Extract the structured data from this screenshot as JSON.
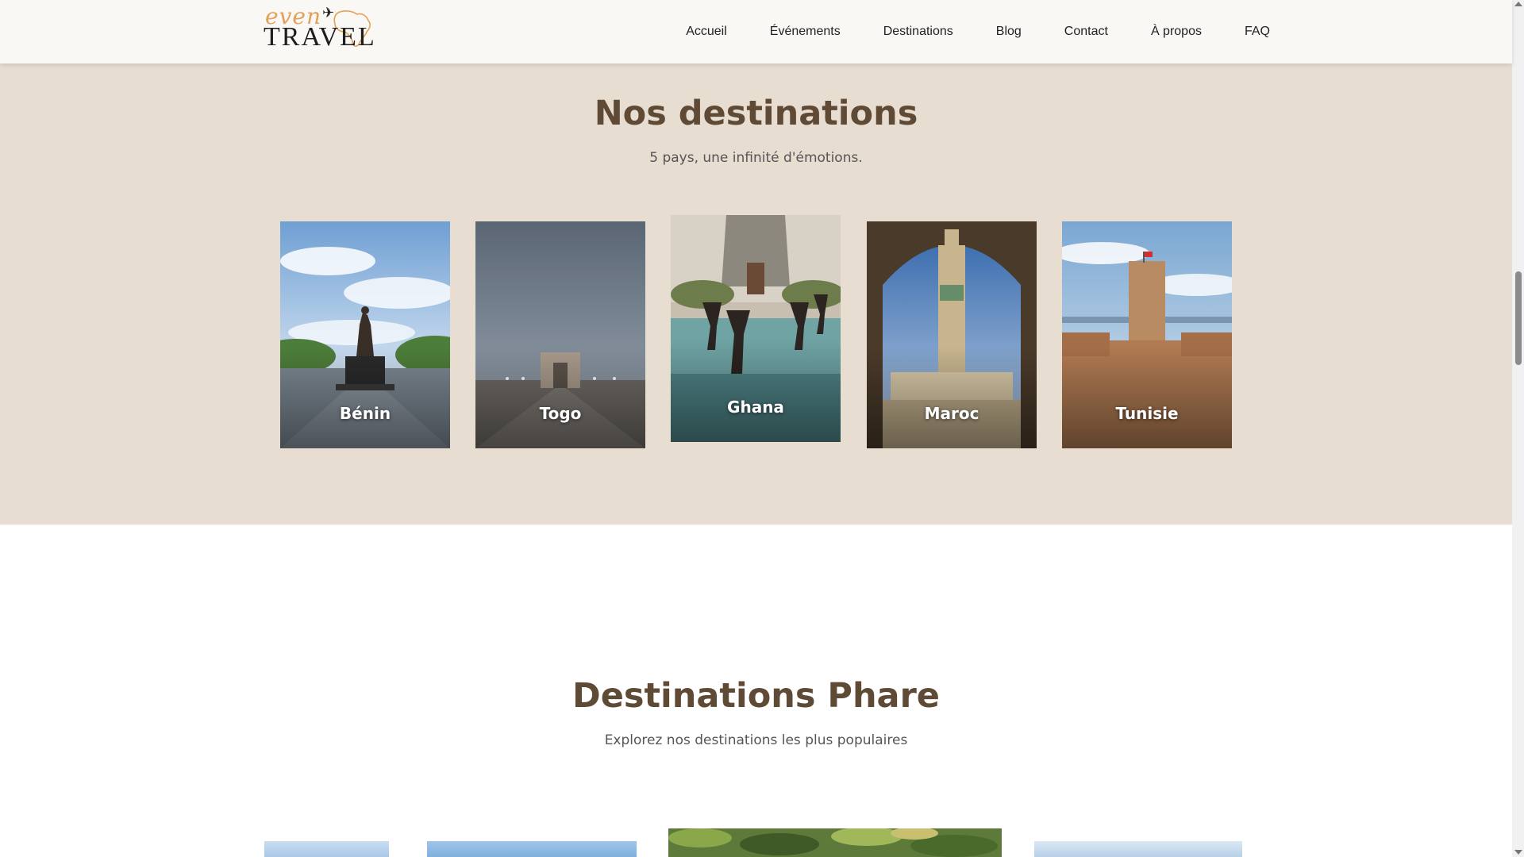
{
  "brand": {
    "logo_top": "even",
    "logo_bottom": "TRAVEL"
  },
  "nav": {
    "items": [
      "Accueil",
      "Événements",
      "Destinations",
      "Blog",
      "Contact",
      "À propos",
      "FAQ"
    ]
  },
  "destinations": {
    "title": "Nos destinations",
    "subtitle": "5 pays, une infinité d'émotions.",
    "cards": [
      {
        "label": "Bénin"
      },
      {
        "label": "Togo"
      },
      {
        "label": "Ghana"
      },
      {
        "label": "Maroc"
      },
      {
        "label": "Tunisie"
      }
    ]
  },
  "featured": {
    "title": "Destinations Phare",
    "subtitle": "Explorez nos destinations les plus populaires"
  },
  "colors": {
    "section_bg": "#e8ddd1",
    "title": "#5e4a35",
    "logo_accent": "#e3a05a"
  }
}
